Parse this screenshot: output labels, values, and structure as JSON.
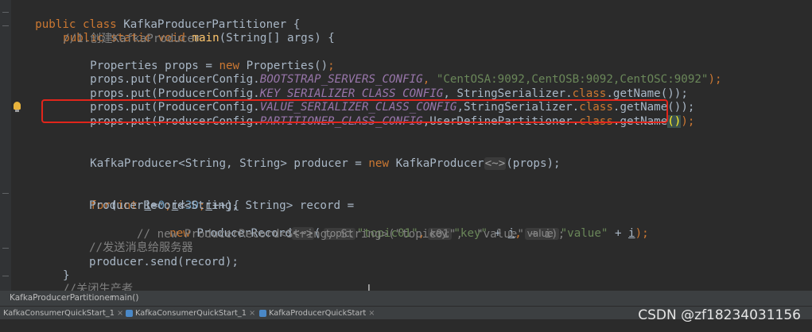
{
  "code": {
    "l1_a": "public class ",
    "l1_b": "KafkaProducerPartitioner {",
    "l2_a": "public static void ",
    "l2_b": "main",
    "l2_c": "(String[] args) {",
    "l3": "//1.创建KafkaProducer",
    "l4_a": "Properties props = ",
    "l4_b": "new ",
    "l4_c": "Properties()",
    "l4_d": ";",
    "l5_a": "props.put(ProducerConfig.",
    "l5_b": "BOOTSTRAP_SERVERS_CONFIG",
    "l5_c": ", ",
    "l5_d": "\"CentOSA:9092,CentOSB:9092,CentOSC:9092\"",
    "l5_e": ");",
    "l6_a": "props.put(ProducerConfig.",
    "l6_b": "KEY_SERIALIZER_CLASS_CONFIG",
    "l6_c": ", StringSerializer.",
    "l6_d": "class",
    "l6_e": ".getName());",
    "l7_a": "props.put(ProducerConfig.",
    "l7_b": "VALUE_SERIALIZER_CLASS_CONFIG",
    "l7_c": ",StringSerializer.",
    "l7_d": "class",
    "l7_e": ".getName());",
    "l8_a": "props.put(ProducerConfig.",
    "l8_b": "PARTITIONER_CLASS_CONFIG",
    "l8_c": ",UserDefinePartitioner.",
    "l8_d": "class",
    "l8_e": ".getName",
    "l8_f": "()",
    "l8_g": ");",
    "l9_a": "KafkaProducer<String, String> producer = ",
    "l9_b": "new ",
    "l9_c": "KafkaProducer",
    "l9_d": "<~>",
    "l9_e": "(props);",
    "l10_a": "for",
    "l10_b": "(",
    "l10_c": "int ",
    "l10_d": "i",
    "l10_e": "=",
    "l10_f": "0",
    "l10_g": ";",
    "l10_h": "i",
    "l10_i": "<",
    "l10_j": "30",
    "l10_k": ";",
    "l10_l": "i",
    "l10_m": "++){",
    "l11": "ProducerRecord<String, String> record =",
    "l12_a": "new ",
    "l12_b": "ProducerRecord",
    "l12_c": "<~>",
    "l12_d": "(",
    "hint_topic": "topic:",
    "l12_e": "\"topic01\"",
    "l12_f": ",",
    "hint_key": "key:",
    "l12_g": "\"key\"",
    "l12_h": " + ",
    "l12_i": "i",
    "l12_j": ",",
    "hint_value": "value:",
    "l12_k": "\"value\"",
    "l12_l": " + ",
    "l12_m": "i",
    "l12_n": ");",
    "l13": "// new ProducerRecord<String, String>(\"topic01\",  \"value\" + i);",
    "l14": "//发送消息给服务器",
    "l15": "producer.send(record);",
    "l16": "}",
    "l17": "//关闭生产者"
  },
  "breadcrumb": {
    "class": "KafkaProducerPartitioner",
    "method": "main()"
  },
  "tabs": [
    {
      "label": "KafkaConsumerQuickStart_1"
    },
    {
      "label": "KafkaConsumerQuickStart_1"
    },
    {
      "label": "KafkaProducerQuickStart"
    }
  ],
  "watermark": "CSDN @zf18234031156",
  "colors": {
    "keyword": "#cc7832",
    "constant": "#9876aa",
    "string": "#6a8759",
    "number": "#6897bb",
    "comment": "#808080",
    "highlight_box": "#e1251b"
  }
}
